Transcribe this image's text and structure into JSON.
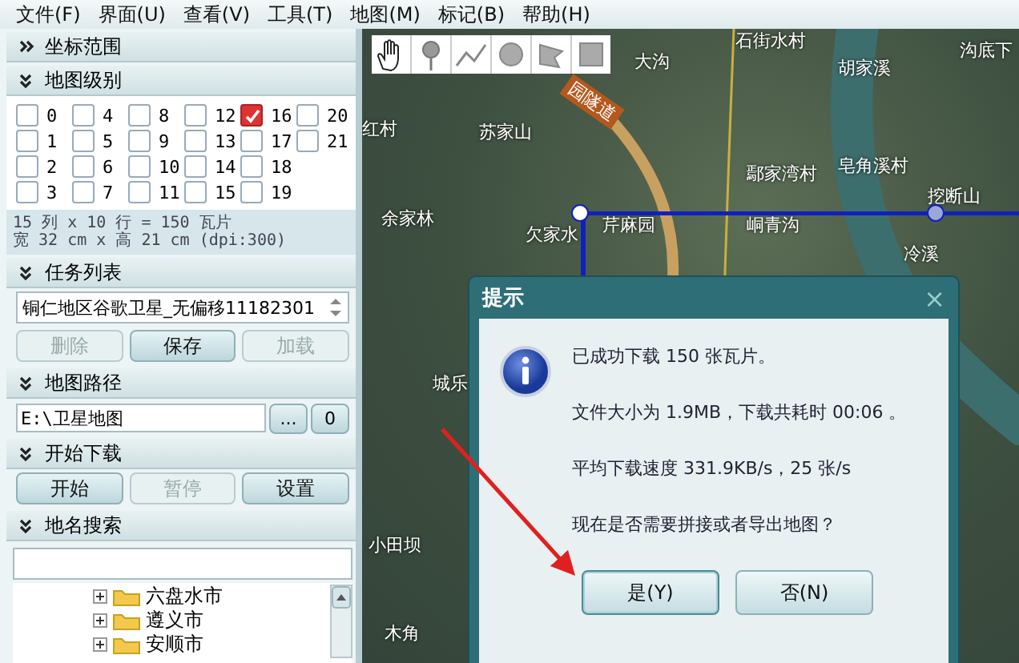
{
  "menu": [
    "文件(F)",
    "界面(U)",
    "查看(V)",
    "工具(T)",
    "地图(M)",
    "标记(B)",
    "帮助(H)"
  ],
  "panel": {
    "coord_section": {
      "title": "坐标范围",
      "expanded": false
    },
    "level_section": {
      "title": "地图级别",
      "expanded": true,
      "levels": [
        {
          "label": "0",
          "checked": false
        },
        {
          "label": "1",
          "checked": false
        },
        {
          "label": "2",
          "checked": false
        },
        {
          "label": "3",
          "checked": false
        },
        {
          "label": "4",
          "checked": false
        },
        {
          "label": "5",
          "checked": false
        },
        {
          "label": "6",
          "checked": false
        },
        {
          "label": "7",
          "checked": false
        },
        {
          "label": "8",
          "checked": false
        },
        {
          "label": "9",
          "checked": false
        },
        {
          "label": "10",
          "checked": false
        },
        {
          "label": "11",
          "checked": false
        },
        {
          "label": "12",
          "checked": false
        },
        {
          "label": "13",
          "checked": false
        },
        {
          "label": "14",
          "checked": false
        },
        {
          "label": "15",
          "checked": false
        },
        {
          "label": "16",
          "checked": true
        },
        {
          "label": "17",
          "checked": false
        },
        {
          "label": "18",
          "checked": false
        },
        {
          "label": "19",
          "checked": false
        },
        {
          "label": "20",
          "checked": false
        },
        {
          "label": "21",
          "checked": false
        }
      ],
      "info": [
        "15 列 x 10 行 = 150 瓦片",
        "宽 32 cm x 高 21 cm (dpi:300)"
      ]
    },
    "task_section": {
      "title": "任务列表",
      "expanded": true,
      "task": "铜仁地区谷歌卫星_无偏移11182301",
      "buttons": [
        {
          "label": "删除",
          "disabled": true
        },
        {
          "label": "保存",
          "disabled": false
        },
        {
          "label": "加载",
          "disabled": true
        }
      ]
    },
    "path_section": {
      "title": "地图路径",
      "expanded": true,
      "path": "E:\\卫星地图",
      "browse": "...",
      "open": "0"
    },
    "download_section": {
      "title": "开始下载",
      "expanded": true,
      "buttons": [
        {
          "label": "开始",
          "disabled": false
        },
        {
          "label": "暂停",
          "disabled": true
        },
        {
          "label": "设置",
          "disabled": false
        }
      ]
    },
    "search_section": {
      "title": "地名搜索",
      "expanded": true,
      "tree": [
        {
          "label": "六盘水市",
          "expanded": false
        },
        {
          "label": "遵义市",
          "expanded": false
        },
        {
          "label": "安顺市",
          "expanded": false
        }
      ]
    }
  },
  "map": {
    "labels": [
      "石街水村",
      "沟底下",
      "大沟",
      "胡家溪",
      "红村",
      "苏家山",
      "鄢家湾村",
      "皂角溪村",
      "挖断山",
      "余家林",
      "芹麻园",
      "峒青沟",
      "欠家水",
      "冷溪",
      "城乐",
      "小田坝",
      "木角"
    ],
    "road_label": "园隧道"
  },
  "dialog": {
    "title": "提示",
    "close": "×",
    "lines": [
      "已成功下载 150 张瓦片。",
      "文件大小为 1.9MB，下载共耗时 00:06 。",
      "平均下载速度 331.9KB/s，25 张/s",
      "现在是否需要拼接或者导出地图？"
    ],
    "buttons": [
      {
        "label": "是(Y)",
        "selected": true
      },
      {
        "label": "否(N)",
        "selected": false
      }
    ]
  }
}
